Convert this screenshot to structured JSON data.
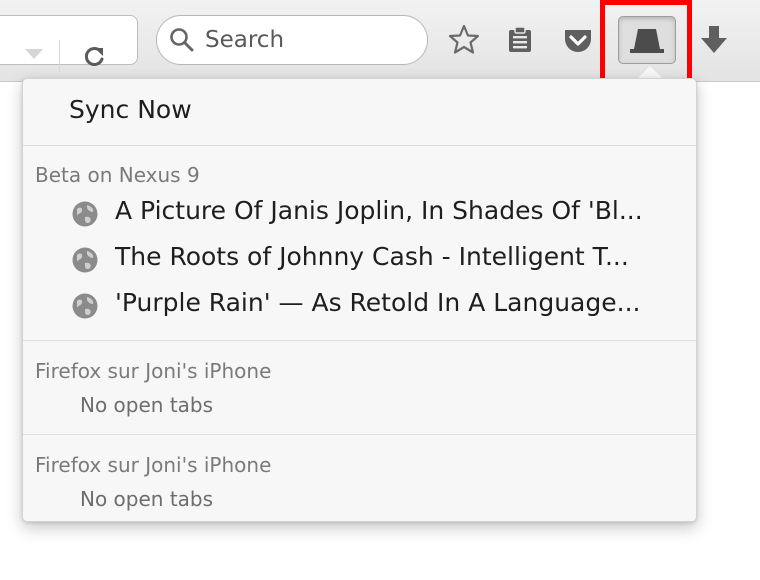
{
  "search": {
    "placeholder": "Search"
  },
  "toolbar": {
    "icons": [
      "dropmarker-icon",
      "reload-icon",
      "search-icon",
      "bookmark-star-icon",
      "reading-list-icon",
      "pocket-icon",
      "synced-tabs-icon",
      "downloads-icon"
    ],
    "highlight_color": "#ff0000"
  },
  "panel": {
    "sync_now_label": "Sync Now",
    "devices": [
      {
        "name": "Beta on Nexus 9",
        "tabs": [
          {
            "title": "A Picture Of Janis Joplin, In Shades Of 'Bl..."
          },
          {
            "title": "The Roots of Johnny Cash - Intelligent T..."
          },
          {
            "title": "'Purple Rain' — As Retold In A Language..."
          }
        ]
      },
      {
        "name": "Firefox sur Joni's iPhone",
        "empty_label": "No open tabs"
      },
      {
        "name": "Firefox sur Joni's iPhone",
        "empty_label": "No open tabs"
      }
    ]
  }
}
